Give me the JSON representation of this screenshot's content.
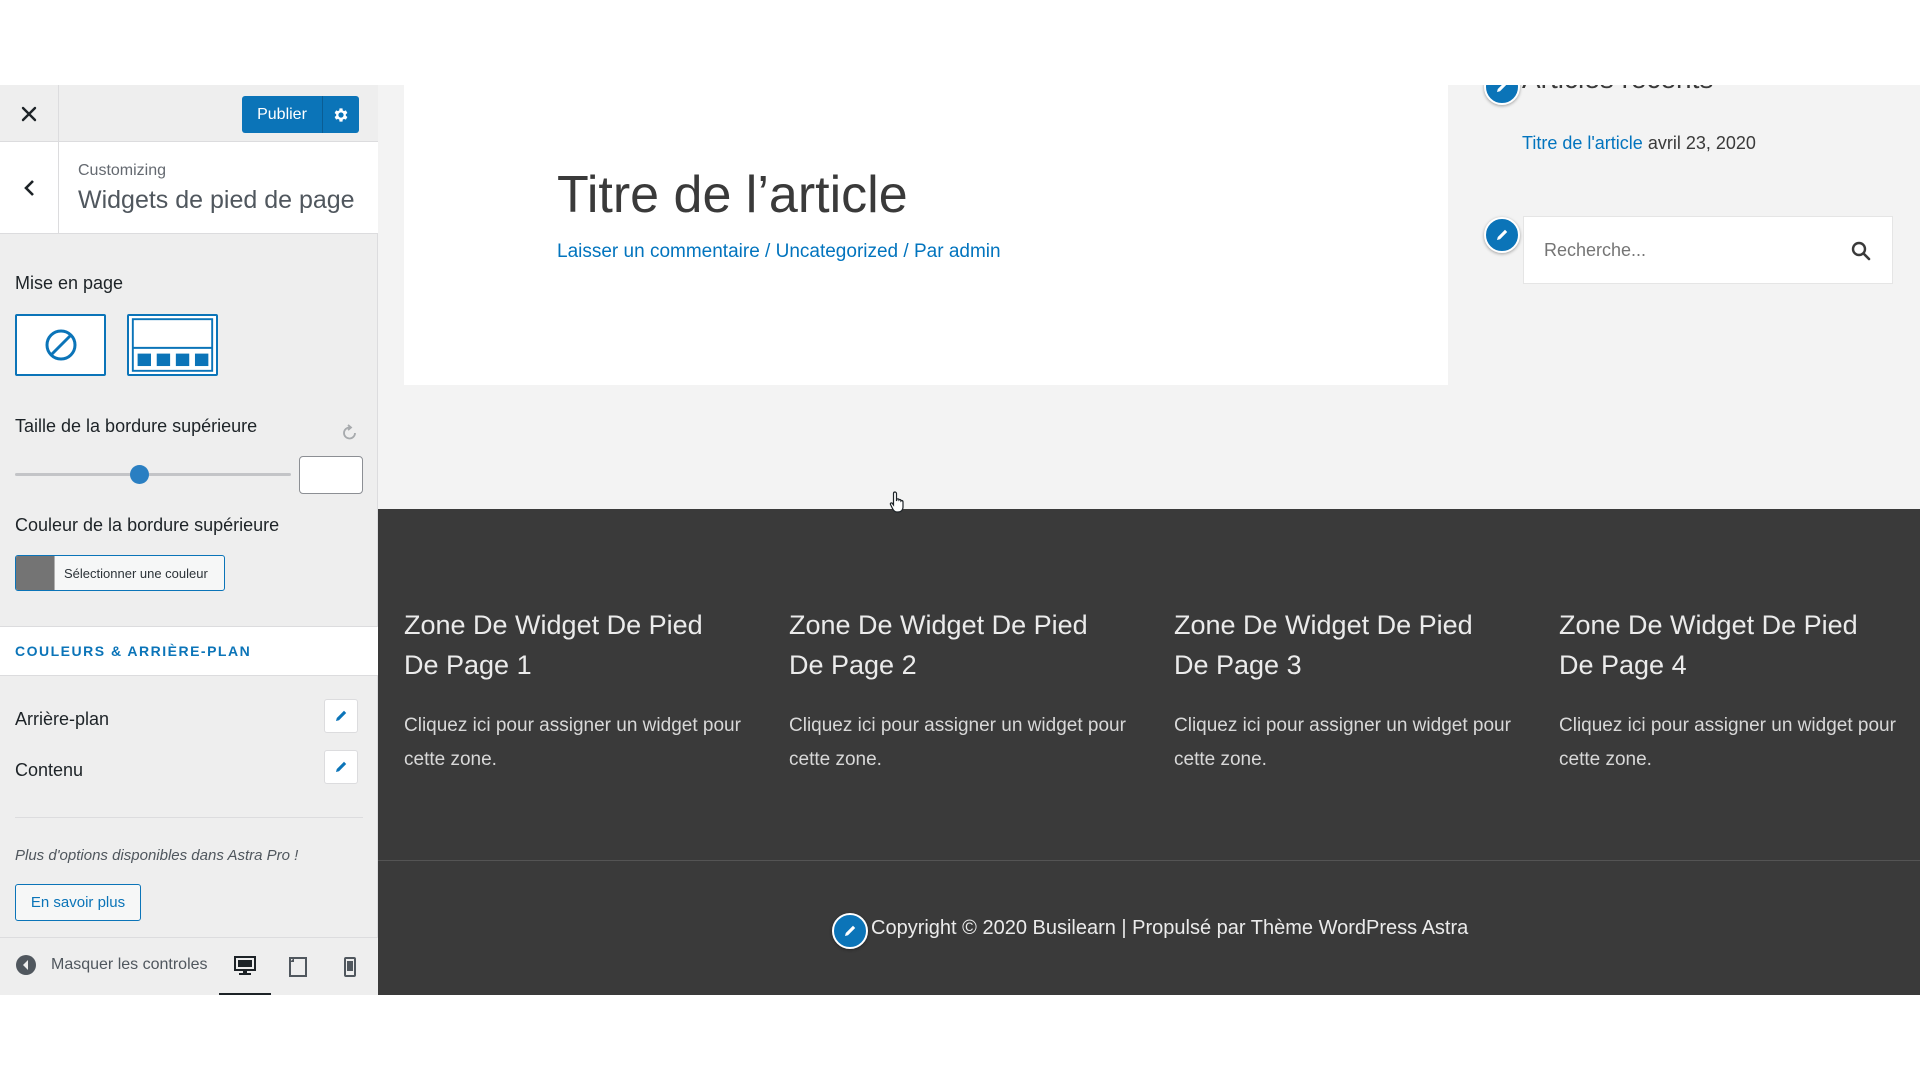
{
  "sidebar": {
    "header": {
      "close_icon": "close-icon",
      "publish_label": "Publier",
      "settings_icon": "gear-icon"
    },
    "title": {
      "back_icon": "chevron-left-icon",
      "customizing_label": "Customizing",
      "section_name": "Widgets de pied de page"
    },
    "layout": {
      "label": "Mise en page",
      "options": [
        {
          "name": "disabled",
          "icon": "no-widgets-icon"
        },
        {
          "name": "four-columns",
          "icon": "four-column-layout-icon",
          "selected": true
        }
      ]
    },
    "border_size": {
      "label": "Taille de la bordure supérieure",
      "slider_value_fraction": 0.45,
      "input_value": ""
    },
    "border_color": {
      "label": "Couleur de la bordure supérieure",
      "button_label": "Sélectionner une couleur",
      "swatch_color": "#747474"
    },
    "colors_section": {
      "heading": "COULEURS & ARRIÈRE-PLAN",
      "rows": [
        {
          "label": "Arrière-plan"
        },
        {
          "label": "Contenu"
        }
      ]
    },
    "pro": {
      "text": "Plus d'options disponibles dans Astra Pro !",
      "button_label": "En savoir plus"
    },
    "footer": {
      "hide_controls_label": "Masquer les controles",
      "devices": [
        "desktop",
        "tablet",
        "mobile"
      ],
      "active_device": "desktop"
    }
  },
  "preview": {
    "article": {
      "title": "Titre de l’article",
      "meta": {
        "comment_link": "Laisser un commentaire",
        "sep1": " / ",
        "category_link": "Uncategorized",
        "sep2": " / ",
        "author_link": "Par admin"
      }
    },
    "sidebar_widgets": {
      "recent_heading": "Articles récents",
      "recent_post_title": "Titre de l'article",
      "recent_post_date": " avril 23, 2020",
      "search_placeholder": "Recherche..."
    },
    "footer_widgets": [
      {
        "title": "Zone De Widget De Pied De Page 1",
        "text": "Cliquez ici pour assigner un widget pour cette zone."
      },
      {
        "title": "Zone De Widget De Pied De Page 2",
        "text": "Cliquez ici pour assigner un widget pour cette zone."
      },
      {
        "title": "Zone De Widget De Pied De Page 3",
        "text": "Cliquez ici pour assigner un widget pour cette zone."
      },
      {
        "title": "Zone De Widget De Pied De Page 4",
        "text": "Cliquez ici pour assigner un widget pour cette zone."
      }
    ],
    "copyright": "Copyright © 2020 Busilearn | Propulsé par Thème WordPress Astra"
  },
  "colors": {
    "accent": "#0b74b8",
    "link": "#0274be",
    "footer_bg": "#3a3a3a"
  }
}
